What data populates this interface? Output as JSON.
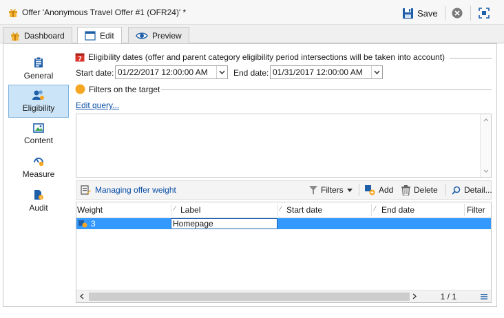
{
  "window": {
    "title": "Offer 'Anonymous Travel Offer #1 (OFR24)' *",
    "save_label": "Save"
  },
  "tabs": [
    {
      "label": "Dashboard"
    },
    {
      "label": "Edit"
    },
    {
      "label": "Preview"
    }
  ],
  "sidebar": {
    "items": [
      {
        "label": "General",
        "icon": "clipboard-icon"
      },
      {
        "label": "Eligibility",
        "icon": "users-icon"
      },
      {
        "label": "Content",
        "icon": "image-icon"
      },
      {
        "label": "Measure",
        "icon": "gauge-icon"
      },
      {
        "label": "Audit",
        "icon": "document-info-icon"
      }
    ],
    "active_index": 1
  },
  "eligibility": {
    "dates_title": "Eligibility dates (offer and parent category eligibility period intersections will be taken into account)",
    "start_label": "Start date:",
    "start_value": "01/22/2017 12:00:00 AM",
    "end_label": "End date:",
    "end_value": "01/31/2017 12:00:00 AM",
    "filters_title": "Filters on the target",
    "edit_query_label": "Edit query..."
  },
  "weights": {
    "title": "Managing offer weight",
    "filters_label": "Filters",
    "add_label": "Add",
    "delete_label": "Delete",
    "detail_label": "Detail...",
    "columns": [
      "Weight",
      "Label",
      "Start date",
      "End date",
      "Filter"
    ],
    "rows": [
      {
        "weight": "3",
        "label": "Homepage",
        "start": "",
        "end": "",
        "filter": ""
      }
    ],
    "pager": "1 / 1"
  },
  "colors": {
    "accent": "#3399ff",
    "link": "#0a4fa6",
    "selected_nav": "#cce4f7",
    "calendar_red": "#d9342b",
    "filter_orange": "#f5a623"
  }
}
